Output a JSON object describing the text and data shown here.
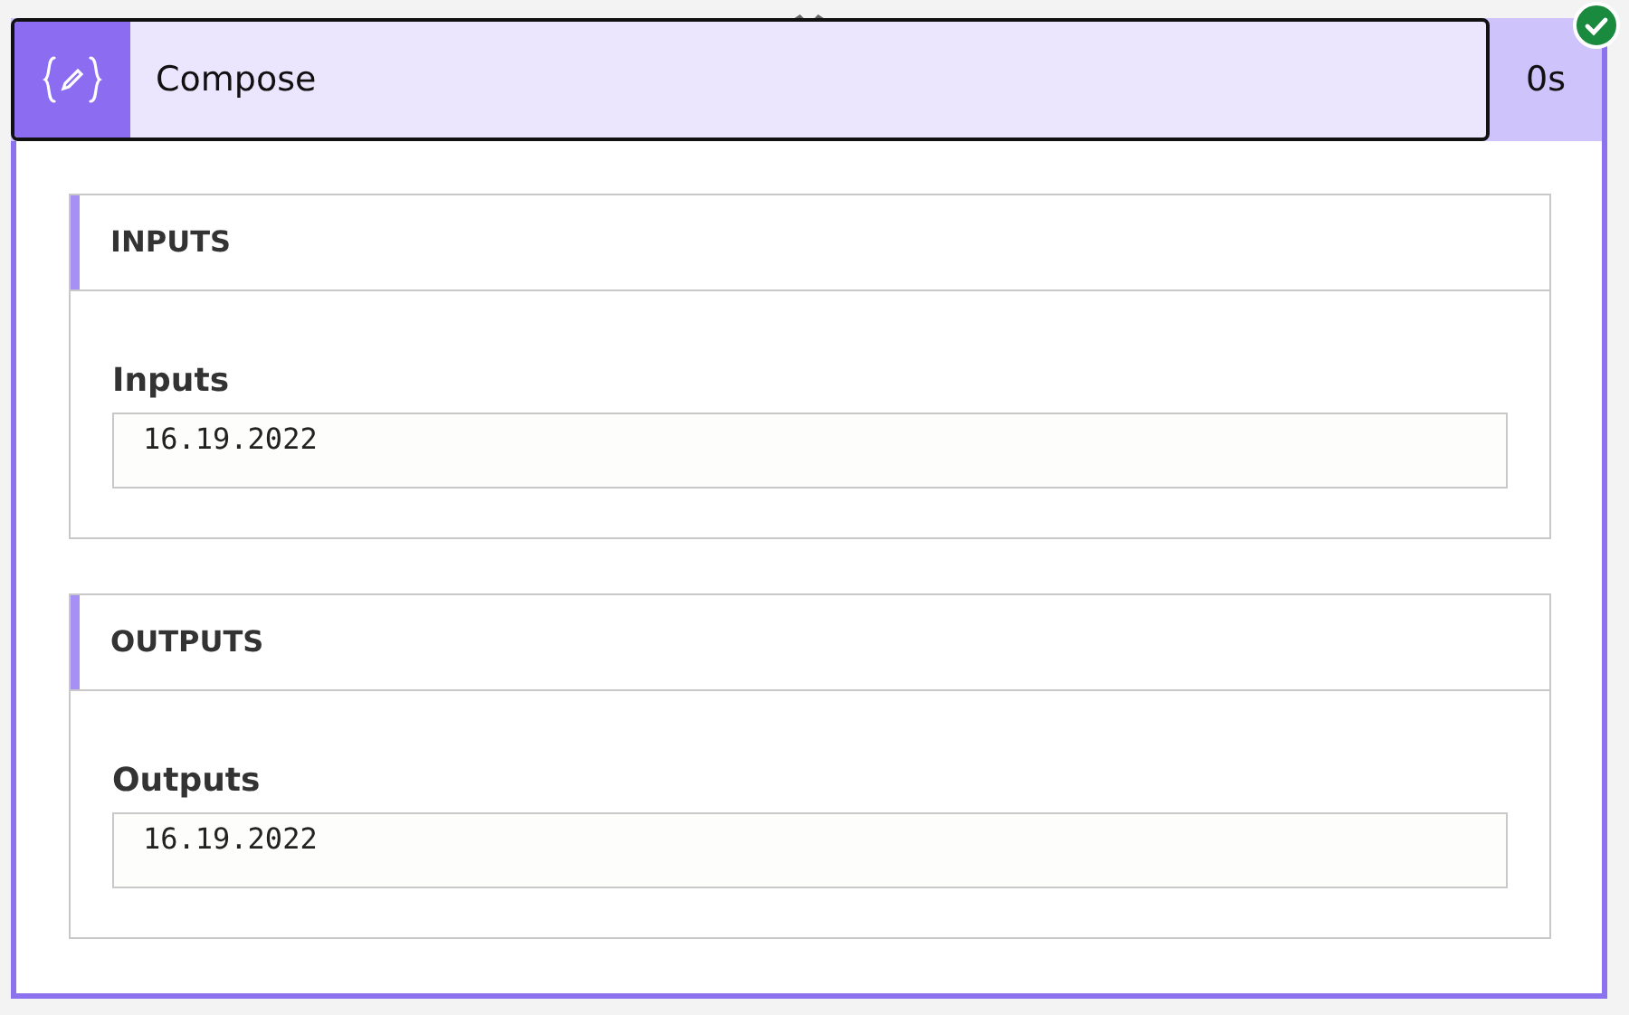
{
  "action": {
    "title": "Compose",
    "duration": "0s",
    "succeeded": true
  },
  "sections": [
    {
      "heading": "INPUTS",
      "fields": [
        {
          "label": "Inputs",
          "value": "16.19.2022"
        }
      ]
    },
    {
      "heading": "OUTPUTS",
      "fields": [
        {
          "label": "Outputs",
          "value": "16.19.2022"
        }
      ]
    }
  ]
}
